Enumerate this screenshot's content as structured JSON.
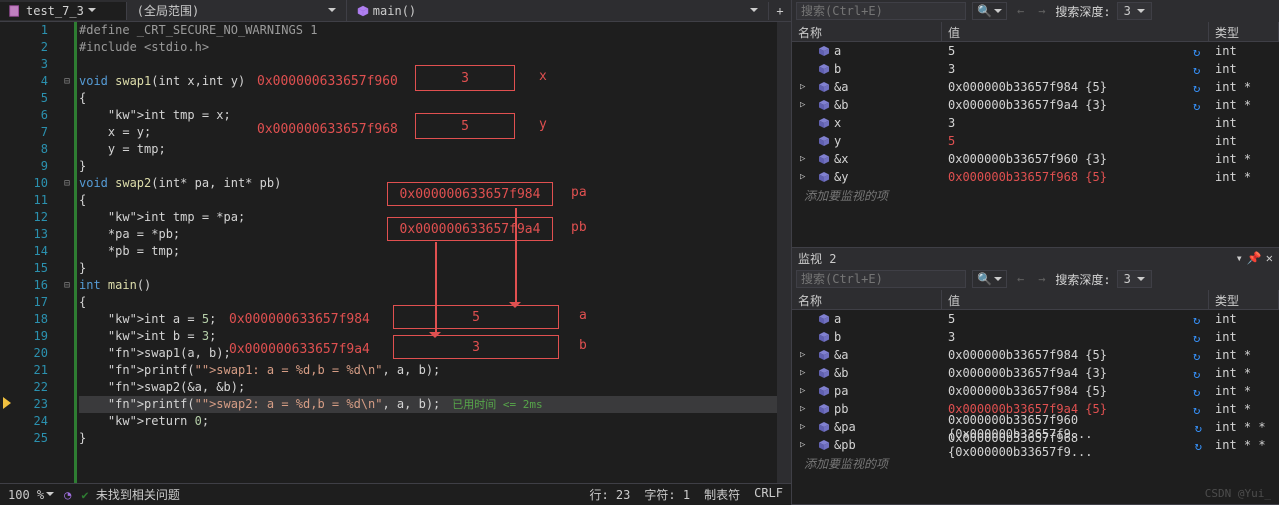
{
  "top": {
    "tab_name": "test_7_3",
    "scope": "(全局范围)",
    "func": "main()",
    "plus": "+"
  },
  "code": [
    {
      "n": "1",
      "f": "",
      "t": "#define _CRT_SECURE_NO_WARNINGS 1",
      "cls": "pp"
    },
    {
      "n": "2",
      "f": "",
      "t": "#include <stdio.h>",
      "cls": "pp"
    },
    {
      "n": "3",
      "f": "",
      "t": ""
    },
    {
      "n": "4",
      "f": "⊟",
      "k1": "void",
      "fn": " swap1",
      "p": "(int x,int y)"
    },
    {
      "n": "5",
      "f": "",
      "t": "{"
    },
    {
      "n": "6",
      "f": "",
      "t": "    int tmp = x;"
    },
    {
      "n": "7",
      "f": "",
      "t": "    x = y;"
    },
    {
      "n": "8",
      "f": "",
      "t": "    y = tmp;"
    },
    {
      "n": "9",
      "f": "",
      "t": "}"
    },
    {
      "n": "10",
      "f": "⊟",
      "k1": "void",
      "fn": " swap2",
      "p": "(int* pa, int* pb)"
    },
    {
      "n": "11",
      "f": "",
      "t": "{"
    },
    {
      "n": "12",
      "f": "",
      "t": "    int tmp = *pa;"
    },
    {
      "n": "13",
      "f": "",
      "t": "    *pa = *pb;"
    },
    {
      "n": "14",
      "f": "",
      "t": "    *pb = tmp;"
    },
    {
      "n": "15",
      "f": "",
      "t": "}"
    },
    {
      "n": "16",
      "f": "⊟",
      "k1": "int",
      "fn": " main",
      "p": "()"
    },
    {
      "n": "17",
      "f": "",
      "t": "{"
    },
    {
      "n": "18",
      "f": "",
      "t": "    int a = 5;"
    },
    {
      "n": "19",
      "f": "",
      "t": "    int b = 3;"
    },
    {
      "n": "20",
      "f": "",
      "t": "    swap1(a, b);"
    },
    {
      "n": "21",
      "f": "",
      "t": "    printf(\"swap1: a = %d,b = %d\\n\", a, b);"
    },
    {
      "n": "22",
      "f": "",
      "t": "    swap2(&a, &b);"
    },
    {
      "n": "23",
      "f": "",
      "t": "    printf(\"swap2: a = %d,b = %d\\n\", a, b);",
      "hi": true,
      "tail": "已用时间 <= 2ms"
    },
    {
      "n": "24",
      "f": "",
      "t": "    return 0;"
    },
    {
      "n": "25",
      "f": "",
      "t": "}"
    }
  ],
  "annot": {
    "addr1": "0x000000633657f960",
    "lbl1": "x",
    "box1": "3",
    "addr2": "0x000000633657f968",
    "lbl2": "y",
    "box2": "5",
    "box3": "0x000000633657f984",
    "lbl3": "pa",
    "box4": "0x000000633657f9a4",
    "lbl4": "pb",
    "addr5": "0x000000633657f984",
    "lbl5": "a",
    "box5": "5",
    "addr6": "0x000000633657f9a4",
    "lbl6": "b",
    "box6": "3"
  },
  "status": {
    "zoom": "100 %",
    "issues": "未找到相关问题",
    "line": "行: 23",
    "col": "字符: 1",
    "tab": "制表符",
    "enc": "CRLF"
  },
  "search": {
    "placeholder": "搜索(Ctrl+E)",
    "depth_label": "搜索深度:",
    "depth_val": "3"
  },
  "watch_head": {
    "name": "名称",
    "val": "值",
    "type": "类型"
  },
  "watch1": [
    {
      "n": "a",
      "v": "5",
      "t": "int",
      "r": true
    },
    {
      "n": "b",
      "v": "3",
      "t": "int",
      "r": true
    },
    {
      "n": "&a",
      "v": "0x000000b33657f984 {5}",
      "t": "int *",
      "e": true,
      "r": true
    },
    {
      "n": "&b",
      "v": "0x000000b33657f9a4 {3}",
      "t": "int *",
      "e": true,
      "r": true
    },
    {
      "n": "x",
      "v": "3",
      "t": "int"
    },
    {
      "n": "y",
      "v": "5",
      "t": "int",
      "red": true
    },
    {
      "n": "&x",
      "v": "0x000000b33657f960 {3}",
      "t": "int *",
      "e": true
    },
    {
      "n": "&y",
      "v": "0x000000b33657f968 {5}",
      "t": "int *",
      "e": true,
      "red": true
    }
  ],
  "add_item": "添加要监视的项",
  "panel2_title": "监视 2",
  "watch2": [
    {
      "n": "a",
      "v": "5",
      "t": "int",
      "r": true
    },
    {
      "n": "b",
      "v": "3",
      "t": "int",
      "r": true
    },
    {
      "n": "&a",
      "v": "0x000000b33657f984 {5}",
      "t": "int *",
      "e": true,
      "r": true
    },
    {
      "n": "&b",
      "v": "0x000000b33657f9a4 {3}",
      "t": "int *",
      "e": true,
      "r": true
    },
    {
      "n": "pa",
      "v": "0x000000b33657f984 {5}",
      "t": "int *",
      "e": true,
      "r": true
    },
    {
      "n": "pb",
      "v": "0x000000b33657f9a4 {5}",
      "t": "int *",
      "e": true,
      "red": true,
      "r": true
    },
    {
      "n": "&pa",
      "v": "0x000000b33657f960 {0x000000b33657f9...",
      "t": "int * *",
      "e": true,
      "r": true
    },
    {
      "n": "&pb",
      "v": "0x000000b33657f968 {0x000000b33657f9...",
      "t": "int * *",
      "e": true,
      "r": true
    }
  ],
  "watermark": "CSDN @Yui_"
}
